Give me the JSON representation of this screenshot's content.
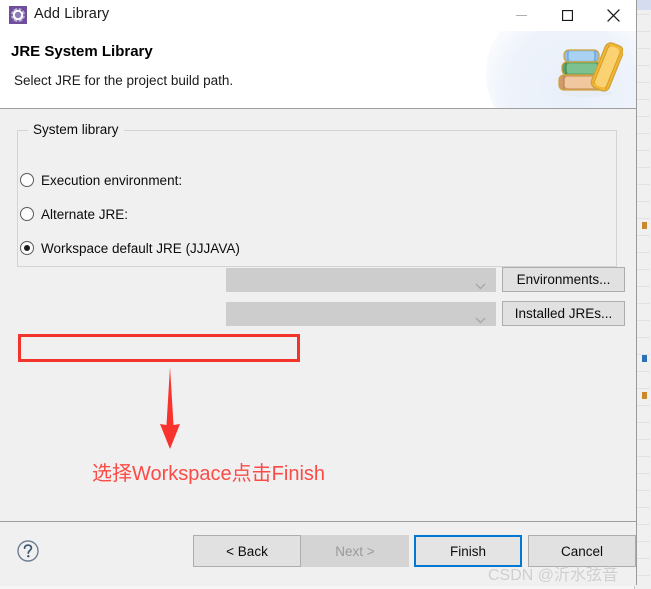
{
  "window": {
    "title": "Add Library",
    "app_icon": "eclipse-library-icon",
    "controls": {
      "minimize_label": "Minimize",
      "maximize_label": "Maximize",
      "close_label": "Close"
    }
  },
  "header": {
    "title": "JRE System Library",
    "subtitle": "Select JRE for the project build path.",
    "banner_icon": "books-stack-icon"
  },
  "main": {
    "group": {
      "legend": "System library",
      "options": [
        {
          "label": "Execution environment:",
          "selected": false
        },
        {
          "label": "Alternate JRE:",
          "selected": false
        },
        {
          "label": "Workspace default JRE (JJJAVA)",
          "selected": true
        }
      ],
      "combos": [
        {
          "value": "",
          "enabled": false
        },
        {
          "value": "",
          "enabled": false
        }
      ],
      "side_buttons": [
        {
          "label": "Environments...",
          "enabled": true
        },
        {
          "label": "Installed JREs...",
          "enabled": true
        }
      ]
    }
  },
  "annotation": {
    "text": "选择Workspace点击Finish",
    "color": "#fb4b46",
    "highlight_color": "#f2342c",
    "arrow": "down-arrow-icon"
  },
  "footer": {
    "help_icon": "question-mark-icon",
    "buttons": [
      {
        "label": "< Back",
        "enabled": true,
        "focused": false
      },
      {
        "label": "Next >",
        "enabled": false,
        "focused": false
      },
      {
        "label": "Finish",
        "enabled": true,
        "focused": true
      },
      {
        "label": "Cancel",
        "enabled": true,
        "focused": false
      }
    ]
  },
  "watermark": {
    "text": "CSDN @沂水弦音"
  },
  "colors": {
    "accent": "#0178d4",
    "annotation_red": "#fb4b46",
    "dialog_bg": "#f0f0f0",
    "disabled_fill": "#cdcdcd"
  }
}
